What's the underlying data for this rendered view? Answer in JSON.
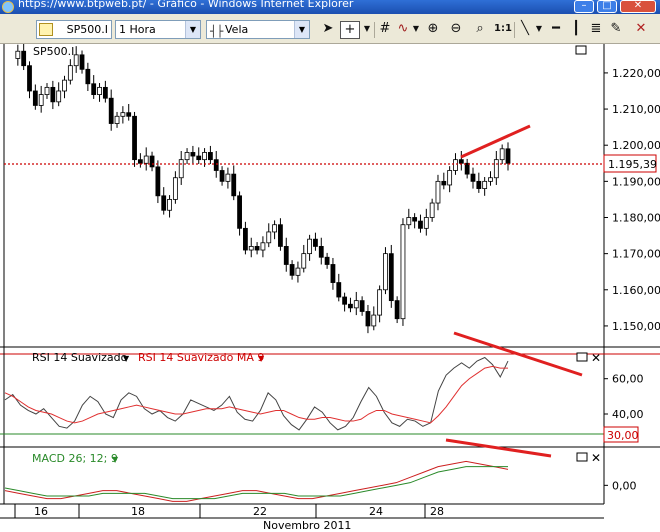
{
  "window": {
    "title": "https://www.btpweb.pt/ - Gráfico - Windows Internet Explorer"
  },
  "toolbar": {
    "symbol": "SP500.I",
    "period": "1 Hora",
    "chart_type": "Vela",
    "zoom_label": "1:1"
  },
  "panels": {
    "price": {
      "symbol_label": "SP500.I",
      "current_value": "1.195,39",
      "y_labels": [
        "1.220,00",
        "1.210,00",
        "1.200,00",
        "1.190,00",
        "1.180,00",
        "1.170,00",
        "1.160,00",
        "1.150,00"
      ]
    },
    "rsi": {
      "label": "RSI 14 Suavizado",
      "ma_label": "RSI 14 Suavizado MA 9",
      "threshold_value": "30,00",
      "y_labels": [
        "60,00",
        "40,00"
      ]
    },
    "macd": {
      "label": "MACD 26; 12; 9",
      "y_labels": [
        "0,00"
      ]
    }
  },
  "x_axis": {
    "tick_labels": [
      "16",
      "18",
      "22",
      "24",
      "28"
    ],
    "month_label": "Novembro 2011"
  },
  "colors": {
    "up_candle": "#000000",
    "down_candle": "#000000",
    "price_line": "#cc0000",
    "rsi_ma": "#e03030",
    "macd_line": "#cc2020",
    "macd_signal": "#2a8a2a",
    "trend_annotation": "#e02020"
  },
  "chart_data": {
    "type": "candlestick",
    "price_axis_range": [
      1145,
      1228
    ],
    "current_price": 1195.39,
    "price_series": [
      1224,
      1226,
      1222,
      1215,
      1211,
      1214,
      1216,
      1212,
      1215,
      1218,
      1222,
      1225,
      1221,
      1217,
      1214,
      1216,
      1213,
      1206,
      1208,
      1209,
      1208,
      1196,
      1195,
      1197,
      1194,
      1186,
      1182,
      1185,
      1191,
      1196,
      1198,
      1197,
      1196,
      1198,
      1196,
      1193,
      1190,
      1192,
      1186,
      1177,
      1171,
      1172,
      1171,
      1173,
      1176,
      1178,
      1172,
      1167,
      1164,
      1166,
      1170,
      1174,
      1172,
      1169,
      1167,
      1162,
      1158,
      1156,
      1155,
      1157,
      1154,
      1150,
      1153,
      1160,
      1170,
      1157,
      1152,
      1178,
      1180,
      1179,
      1177,
      1180,
      1184,
      1190,
      1189,
      1193,
      1196,
      1195,
      1192,
      1190,
      1188,
      1190,
      1191,
      1196,
      1199,
      1195
    ],
    "rsi_threshold": 30,
    "rsi_axis_range": [
      23,
      74
    ],
    "rsi_series": [
      48,
      51,
      45,
      42,
      40,
      43,
      38,
      33,
      32,
      36,
      45,
      50,
      47,
      40,
      38,
      48,
      52,
      50,
      43,
      40,
      42,
      38,
      36,
      40,
      48,
      46,
      44,
      42,
      45,
      50,
      41,
      37,
      36,
      42,
      52,
      48,
      39,
      34,
      31,
      37,
      44,
      41,
      35,
      31,
      33,
      38,
      47,
      55,
      50,
      41,
      35,
      33,
      37,
      36,
      33,
      35,
      53,
      62,
      66,
      69,
      66,
      70,
      72,
      68,
      61,
      70
    ],
    "rsi_ma_series": [
      52,
      50,
      47,
      44,
      42,
      41,
      40,
      38,
      36,
      35,
      36,
      38,
      40,
      41,
      42,
      43,
      44,
      45,
      44,
      43,
      42,
      41,
      40,
      40,
      41,
      42,
      43,
      43,
      43,
      44,
      43,
      42,
      41,
      40,
      41,
      42,
      42,
      40,
      38,
      37,
      37,
      38,
      38,
      37,
      36,
      36,
      37,
      40,
      42,
      42,
      40,
      39,
      38,
      37,
      36,
      35,
      39,
      44,
      50,
      56,
      60,
      63,
      66,
      67,
      66,
      66
    ],
    "macd_zero": 0,
    "macd_series": [
      -2,
      -3,
      -4,
      -5,
      -5,
      -4,
      -3,
      -2,
      -2,
      -3,
      -4,
      -5,
      -6,
      -6,
      -5,
      -4,
      -3,
      -2,
      -2,
      -3,
      -4,
      -5,
      -5,
      -4,
      -3,
      -2,
      -1,
      0,
      1,
      3,
      5,
      7,
      8,
      9,
      8,
      7,
      6
    ],
    "macd_signal_series": [
      -1,
      -2,
      -3,
      -4,
      -4,
      -4,
      -4,
      -3,
      -3,
      -3,
      -3,
      -4,
      -5,
      -5,
      -5,
      -5,
      -4,
      -3,
      -3,
      -3,
      -3,
      -4,
      -4,
      -4,
      -4,
      -3,
      -2,
      -1,
      0,
      1,
      3,
      5,
      6,
      7,
      7,
      7,
      7
    ]
  }
}
